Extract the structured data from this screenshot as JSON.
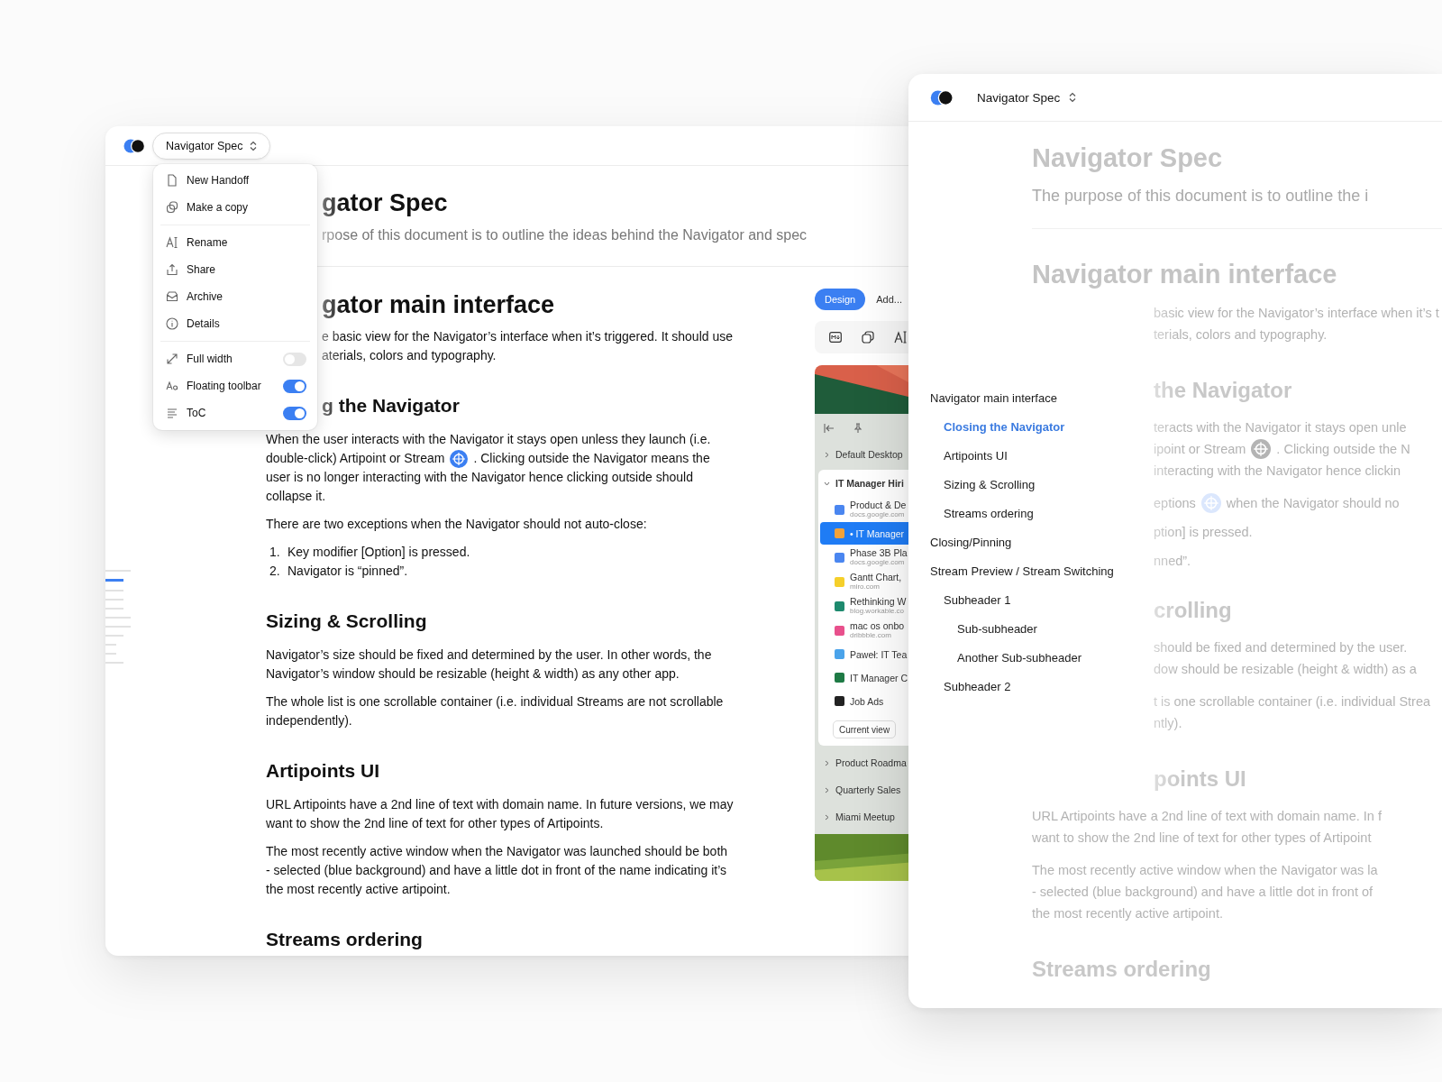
{
  "left_window": {
    "title_button": "Navigator Spec",
    "menu": {
      "groups": [
        {
          "items": [
            {
              "kind": "action",
              "label": "New Handoff"
            },
            {
              "kind": "action",
              "label": "Make a copy"
            }
          ]
        },
        {
          "items": [
            {
              "kind": "action",
              "label": "Rename"
            },
            {
              "kind": "action",
              "label": "Share"
            },
            {
              "kind": "action",
              "label": "Archive"
            },
            {
              "kind": "action",
              "label": "Details"
            }
          ]
        },
        {
          "items": [
            {
              "kind": "toggle",
              "label": "Full width",
              "on": false
            },
            {
              "kind": "toggle",
              "label": "Floating toolbar",
              "on": true
            },
            {
              "kind": "toggle",
              "label": "ToC",
              "on": true
            }
          ]
        }
      ]
    },
    "document": [
      {
        "kind": "h1",
        "lines": [
          {
            "text": "gator Spec",
            "cut": true
          }
        ]
      },
      {
        "kind": "sub",
        "lines": [
          {
            "text": "rpose of this document is to outline the ideas behind the Navigator and spec",
            "cut": true
          }
        ]
      },
      {
        "kind": "rule"
      },
      {
        "kind": "h2",
        "lines": [
          {
            "text": "gator main interface",
            "cut": true
          }
        ]
      },
      {
        "kind": "p",
        "lines": [
          {
            "text": "e basic view for the Navigator’s interface when it’s triggered. It should use",
            "cut": true
          },
          {
            "text": "aterials, colors and typography.",
            "cut": true
          }
        ]
      },
      {
        "kind": "h3",
        "lines": [
          {
            "text": "g the Navigator",
            "cut": true
          }
        ]
      },
      {
        "kind": "p",
        "lines": [
          {
            "text": "When the user interacts with the Navigator it stays open unless they launch (i.e.",
            "cut": false
          },
          {
            "text": "double-click) Artipoint or Stream",
            "kind": "accent",
            "after": ". Clicking outside the Navigator means the",
            "cut": false
          },
          {
            "text": "user is no longer interacting with the Navigator hence clicking outside should",
            "cut": false
          },
          {
            "text": "collapse it.",
            "cut": false
          }
        ]
      },
      {
        "kind": "p",
        "lines": [
          {
            "text": "There are two exceptions when the Navigator should not auto-close:",
            "cut": false
          }
        ]
      },
      {
        "kind": "ol",
        "items": [
          {
            "number": "1.",
            "text": "Key modifier [Option] is pressed."
          },
          {
            "number": "2.",
            "text": "Navigator is “pinned”."
          }
        ]
      },
      {
        "kind": "h3",
        "lines": [
          {
            "text": "Sizing & Scrolling",
            "cut": false
          }
        ]
      },
      {
        "kind": "p",
        "lines": [
          {
            "text": "Navigator’s size should be fixed and determined by the user. In other words, the",
            "cut": false
          },
          {
            "text": "Navigator’s window should be resizable (height & width) as any other app.",
            "cut": false
          }
        ]
      },
      {
        "kind": "p",
        "lines": [
          {
            "text": "The whole list is one scrollable container (i.e. individual Streams are not scrollable",
            "cut": false
          },
          {
            "text": "independently).",
            "cut": false
          }
        ]
      },
      {
        "kind": "h3",
        "lines": [
          {
            "text": "Artipoints UI",
            "cut": false
          }
        ]
      },
      {
        "kind": "p",
        "lines": [
          {
            "text": "URL Artipoints have a 2nd line of text with domain name. In future versions, we may",
            "cut": false
          },
          {
            "text": "want to show the 2nd line of text for other types of Artipoints.",
            "cut": false
          }
        ]
      },
      {
        "kind": "p",
        "lines": [
          {
            "text": "The most recently active window when the Navigator was launched should be both",
            "cut": false
          },
          {
            "text": "- selected (blue background) and have a little dot in front of the name indicating it’s",
            "cut": false
          },
          {
            "text": "the most recently active artipoint.",
            "cut": false
          }
        ]
      },
      {
        "kind": "h3",
        "lines": [
          {
            "text": "Streams ordering",
            "cut": false
          }
        ]
      }
    ],
    "embedded_panel": {
      "design_button": "Design",
      "add_label": "Add...",
      "groups": [
        {
          "label": "Default Desktop",
          "expanded": false
        },
        {
          "label": "IT Manager Hiri",
          "expanded": true,
          "current_view": "Current view",
          "items": [
            {
              "title": "Product & De",
              "subtitle": "docs.google.com",
              "color": "#4a86f0",
              "selected": false
            },
            {
              "title": "• IT Manager",
              "color": "#f2a23a",
              "selected": true
            },
            {
              "title": "Phase 3B Pla",
              "subtitle": "docs.google.com",
              "color": "#4a86f0",
              "selected": false
            },
            {
              "title": "Gantt Chart,",
              "subtitle": "miro.com",
              "color": "#f5cf2a",
              "selected": false
            },
            {
              "title": "Rethinking W",
              "subtitle": "blog.workable.co",
              "color": "#1e8a6e",
              "selected": false
            },
            {
              "title": "mac os onbo",
              "subtitle": "dribbble.com",
              "color": "#e8508c",
              "selected": false
            },
            {
              "title": "Paweł: IT Tea",
              "color": "#4aa3ea",
              "selected": false
            },
            {
              "title": "IT Manager C",
              "color": "#1e7a45",
              "selected": false
            },
            {
              "title": "Job Ads",
              "color": "#222222",
              "selected": false
            }
          ]
        },
        {
          "label": "Product Roadma",
          "expanded": false
        },
        {
          "label": "Quarterly Sales",
          "expanded": false
        },
        {
          "label": "Miami Meetup",
          "expanded": false
        }
      ]
    }
  },
  "right_window": {
    "title": "Navigator Spec",
    "document": [
      {
        "kind": "h1",
        "lines": [
          {
            "text": "Navigator Spec",
            "cut": false
          }
        ]
      },
      {
        "kind": "sub",
        "lines": [
          {
            "text": "The purpose of this document is to outline the i",
            "cut": false
          }
        ]
      },
      {
        "kind": "rule"
      },
      {
        "kind": "h2",
        "lines": [
          {
            "text": "Navigator main interface",
            "cut": false
          }
        ]
      },
      {
        "kind": "p",
        "lines": [
          {
            "text": "basic view for the Navigator’s interface when it’s t",
            "cut": true
          },
          {
            "text": "terials, colors and typography.",
            "cut": true
          }
        ]
      },
      {
        "kind": "h3",
        "lines": [
          {
            "text": "the Navigator",
            "cut": true
          }
        ]
      },
      {
        "kind": "p",
        "lines": [
          {
            "text": "teracts with the Navigator it stays open unle",
            "cut": true
          },
          {
            "text": "ipoint or Stream",
            "kind": "muted",
            "after": ". Clicking outside the N",
            "cut": true
          },
          {
            "text": "interacting with the Navigator hence clickin",
            "cut": true
          }
        ]
      },
      {
        "kind": "p",
        "lines": [
          {
            "text": "eptions",
            "kind": "accent",
            "after": "when the Navigator should no",
            "cut": true
          }
        ]
      },
      {
        "kind": "li",
        "lines": [
          {
            "text": "ption] is pressed.",
            "cut": true
          },
          {
            "text": "nned”.",
            "cut": true
          }
        ]
      },
      {
        "kind": "h3",
        "lines": [
          {
            "text": "crolling",
            "cut": true
          }
        ]
      },
      {
        "kind": "p",
        "lines": [
          {
            "text": "should be fixed and determined by the user.",
            "cut": true
          },
          {
            "text": "dow should be resizable (height & width) as a",
            "cut": true
          }
        ]
      },
      {
        "kind": "p",
        "lines": [
          {
            "text": "t is one scrollable container (i.e. individual Strea",
            "cut": true
          },
          {
            "text": "ntly).",
            "cut": true
          }
        ]
      },
      {
        "kind": "h3",
        "lines": [
          {
            "text": "points UI",
            "cut": true
          }
        ]
      },
      {
        "kind": "p",
        "lines": [
          {
            "text": "URL Artipoints have a 2nd line of text with domain name. In f",
            "cut": false
          },
          {
            "text": "want to show the 2nd line of text for other types of Artipoint",
            "cut": false
          }
        ]
      },
      {
        "kind": "p",
        "lines": [
          {
            "text": "The most recently active window when the Navigator was la",
            "cut": false
          },
          {
            "text": "- selected (blue background) and have a little dot in front of",
            "cut": false
          },
          {
            "text": "the most recently active artipoint.",
            "cut": false
          }
        ]
      },
      {
        "kind": "h3",
        "lines": [
          {
            "text": "Streams ordering",
            "cut": false
          }
        ]
      }
    ],
    "toc": [
      {
        "label": "Navigator main interface",
        "selected": false,
        "children": [
          {
            "label": "Closing the Navigator",
            "selected": true
          },
          {
            "label": "Artipoints UI",
            "selected": false
          },
          {
            "label": "Sizing & Scrolling",
            "selected": false
          },
          {
            "label": "Streams ordering",
            "selected": false
          }
        ]
      },
      {
        "label": "Closing/Pinning",
        "selected": false
      },
      {
        "label": "Stream Preview / Stream Switching",
        "selected": false,
        "children": [
          {
            "label": "Subheader 1",
            "selected": false,
            "children": [
              {
                "label": "Sub-subheader",
                "selected": false
              },
              {
                "label": "Another Sub-subheader",
                "selected": false
              }
            ]
          },
          {
            "label": "Subheader 2",
            "selected": false
          }
        ]
      }
    ]
  }
}
